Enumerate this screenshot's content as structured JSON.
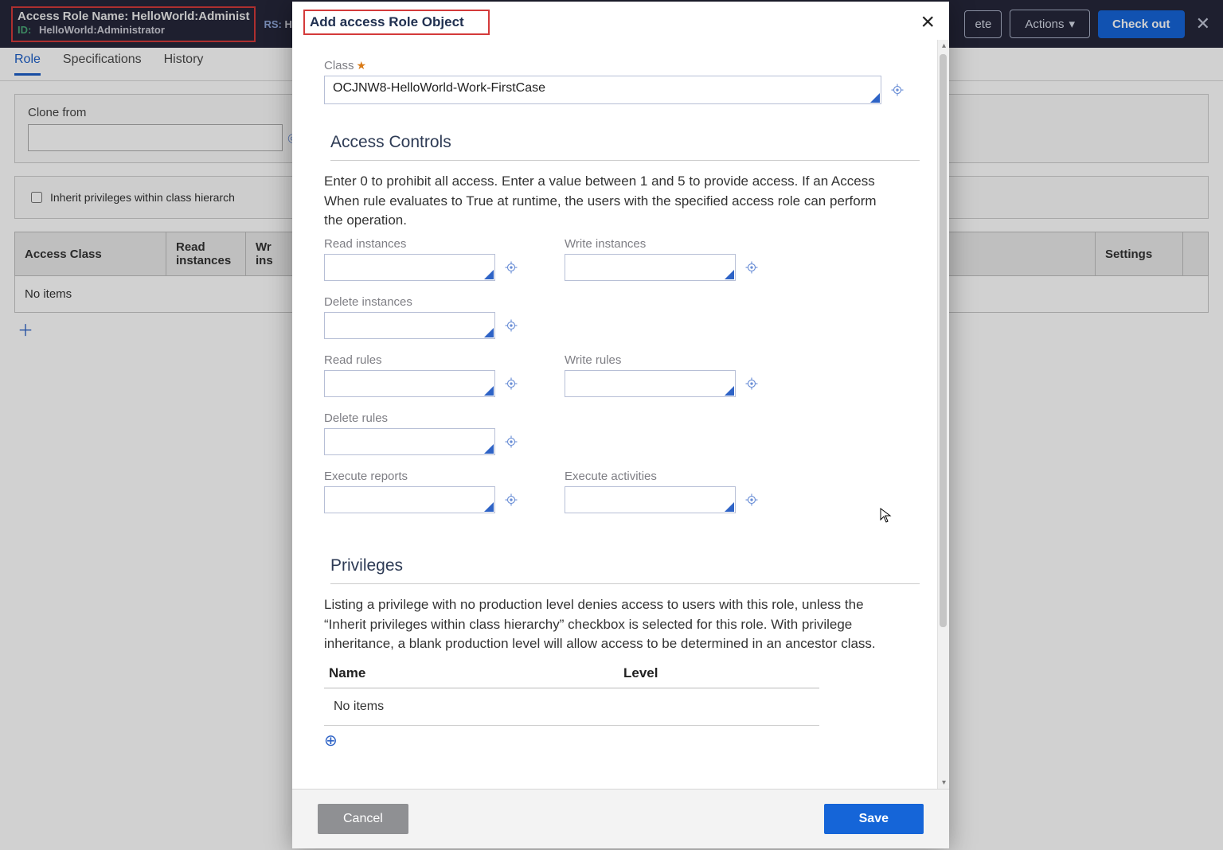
{
  "header": {
    "title_prefix": "Access Role Name: ",
    "title_value": "HelloWorld:Administ",
    "id_label": "ID:",
    "id_value": "HelloWorld:Administrator",
    "rs_label": "RS:",
    "rs_value": "HelloWo",
    "delete_button": "ete",
    "actions_button": "Actions",
    "checkout_button": "Check out"
  },
  "tabs": {
    "role": "Role",
    "specifications": "Specifications",
    "history": "History"
  },
  "bg": {
    "clone_from_label": "Clone from",
    "inherit_label": "Inherit privileges within class hierarch",
    "table": {
      "col_access_class": "Access Class",
      "col_read": "Read instances",
      "col_write_prefix": "Wr",
      "col_write_suffix": "ins",
      "col_settings": "Settings",
      "no_items": "No items"
    }
  },
  "modal": {
    "title": "Add access Role Object",
    "class_label": "Class",
    "class_value": "OCJNW8-HelloWorld-Work-FirstCase",
    "section_access": "Access Controls",
    "access_help": "Enter 0 to prohibit all access. Enter a value between 1 and 5 to provide access. If an Access When rule evaluates to True at runtime, the users with the specified access role can perform the operation.",
    "fields": {
      "read_instances": "Read instances",
      "write_instances": "Write instances",
      "delete_instances": "Delete instances",
      "read_rules": "Read rules",
      "write_rules": "Write rules",
      "delete_rules": "Delete rules",
      "execute_reports": "Execute reports",
      "execute_activities": "Execute activities"
    },
    "section_priv": "Privileges",
    "priv_help": "Listing a privilege with no production level denies access to users with this role, unless the “Inherit privileges within class hierarchy” checkbox is selected for this role. With privilege inheritance, a blank production level will allow access to be determined in an ancestor class.",
    "priv_table": {
      "col_name": "Name",
      "col_level": "Level",
      "no_items": "No items"
    },
    "cancel": "Cancel",
    "save": "Save"
  }
}
